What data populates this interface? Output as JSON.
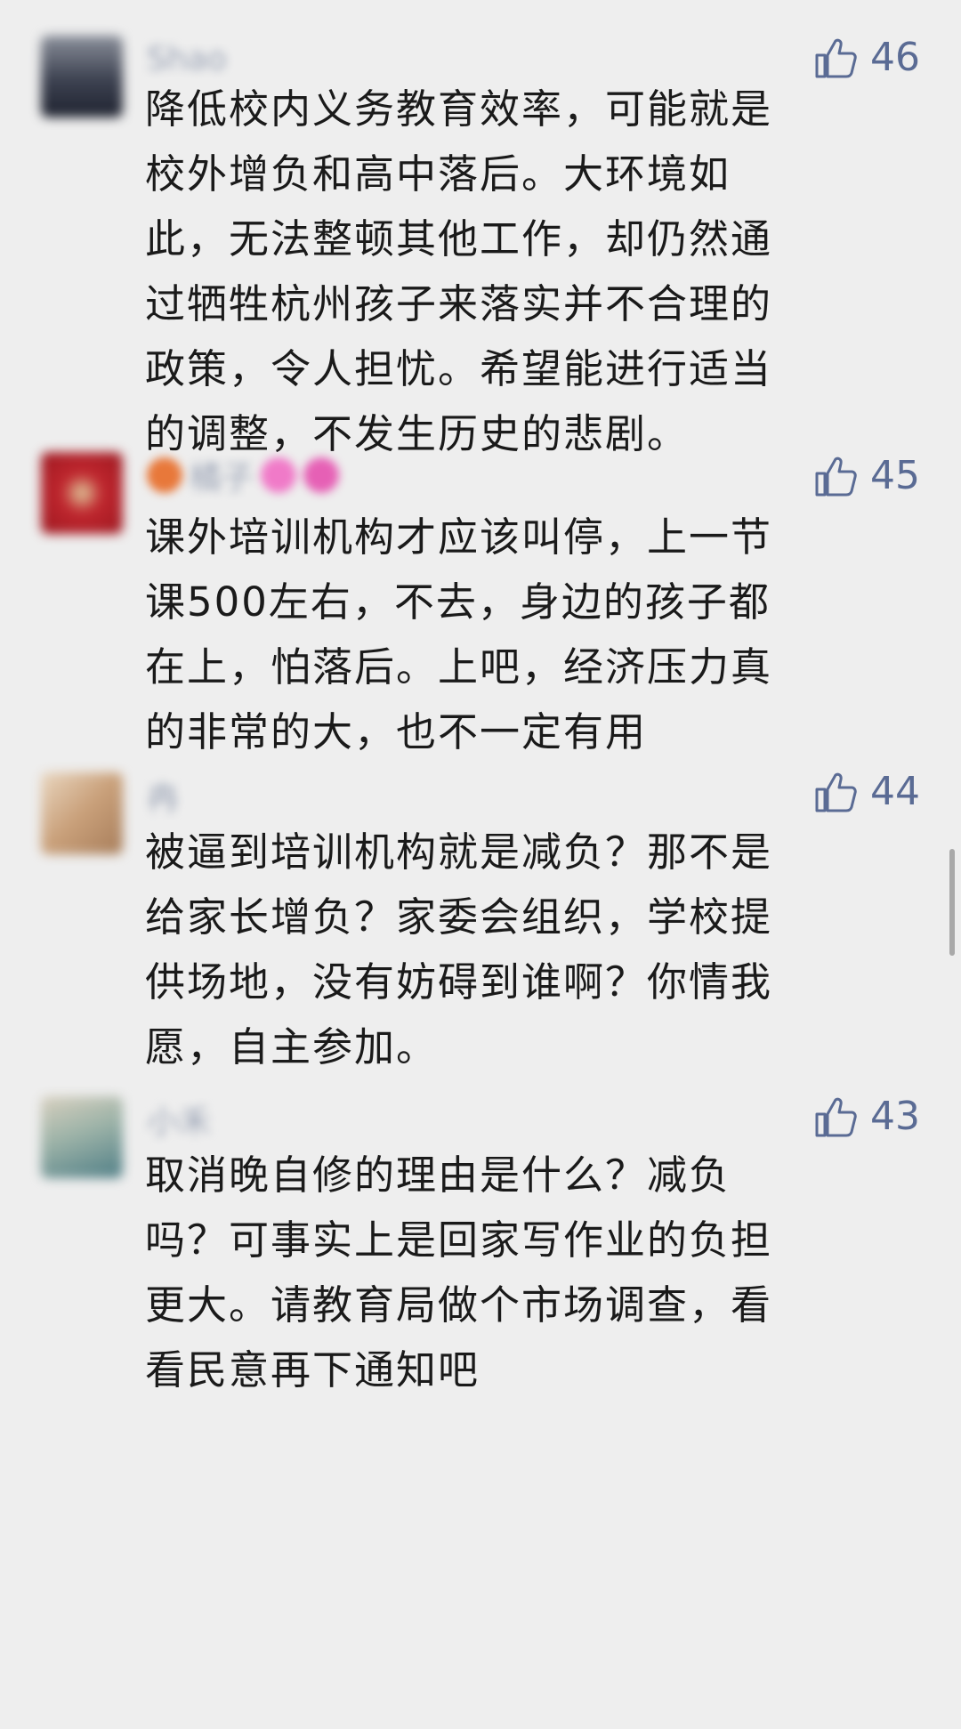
{
  "comments": [
    {
      "username": "Shao",
      "likes": "46",
      "text": "降低校内义务教育效率，可能就是\n校外增负和高中落后。大环境如\n此，无法整顿其他工作，却仍然通\n过牺牲杭州孩子来落实并不合理的\n政策，令人担忧。希望能进行适当\n的调整，不发生历史的悲剧。",
      "avatar_color": "#4a4f5e"
    },
    {
      "username": "橘子",
      "likes": "45",
      "text": "课外培训机构才应该叫停，上一节\n课500左右，不去，身边的孩子都\n在上，怕落后。上吧，经济压力真\n的非常的大，也不一定有用",
      "avatar_color": "#b0222a"
    },
    {
      "username": "冉",
      "likes": "44",
      "text": "被逼到培训机构就是减负？那不是\n给家长增负？家委会组织，学校提\n供场地，没有妨碍到谁啊？你情我\n愿，自主参加。",
      "avatar_color": "#c8a584"
    },
    {
      "username": "小禾",
      "likes": "43",
      "text": "取消晚自修的理由是什么？减负\n吗？可事实上是回家写作业的负担\n更大。请教育局做个市场调查，看\n看民意再下通知吧",
      "avatar_color": "#8fa59a"
    }
  ],
  "icons": {
    "like": "thumbs-up-icon"
  },
  "colors": {
    "background": "#eeeeee",
    "text": "#1a1a1a",
    "like": "#5a6b94"
  }
}
